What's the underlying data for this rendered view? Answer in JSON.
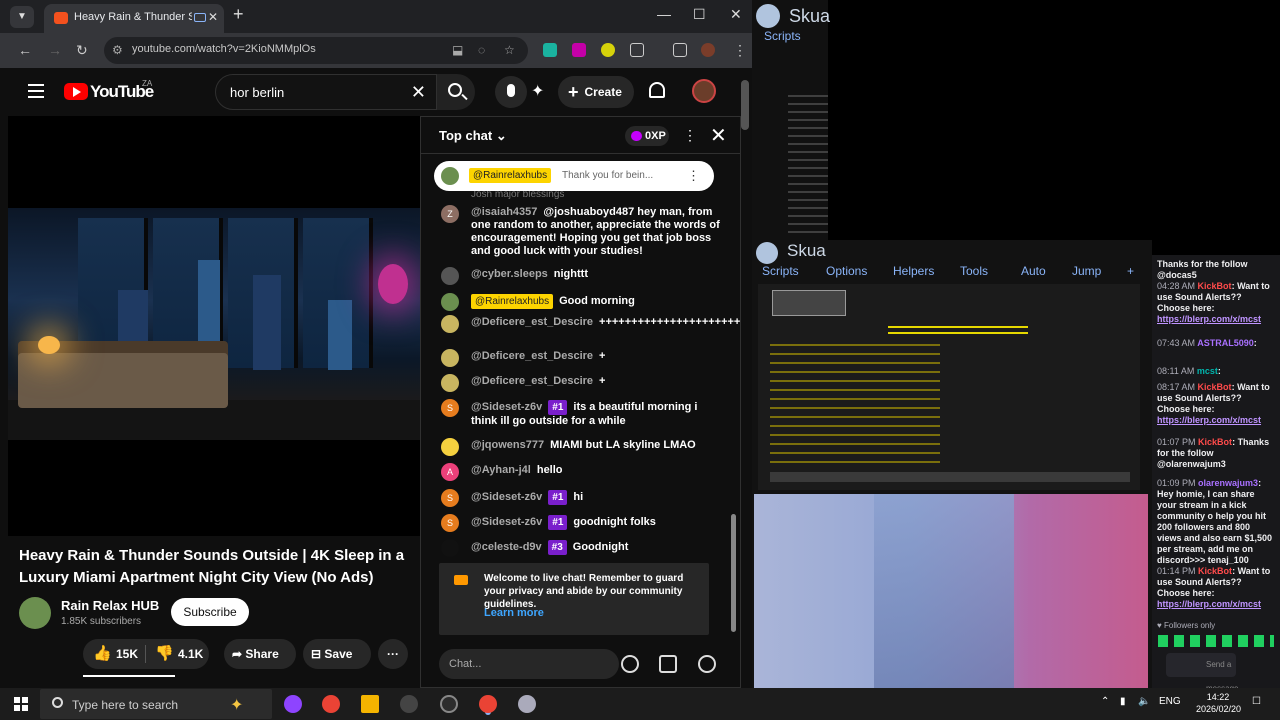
{
  "browser": {
    "tab_title": "Heavy Rain & Thunder Sou",
    "url": "youtube.com/watch?v=2KioNMMplOs"
  },
  "youtube": {
    "logo_text": "YouTube",
    "country": "ZA",
    "search_value": "hor berlin",
    "create_label": "Create",
    "video_title": "Heavy Rain & Thunder Sounds Outside | 4K Sleep in a Luxury Miami Apartment Night City View (No Ads)",
    "channel_name": "Rain Relax HUB",
    "subscribers": "1.85K subscribers",
    "subscribe_label": "Subscribe",
    "likes": "15K",
    "dislikes": "4.1K",
    "share_label": "Share",
    "save_label": "Save"
  },
  "chat": {
    "title": "Top chat",
    "xp": "0XP",
    "pinned": {
      "author": "@Rainrelaxhubs",
      "text": "Thank you for bein..."
    },
    "cut_line": "Josh major blessings",
    "messages": [
      {
        "initial": "Z",
        "color": "#8d6e63",
        "author": "@isaiah4357",
        "badge": "",
        "mod": false,
        "text": "@joshuaboyd487 hey man, from one random to another, appreciate the words of encouragement! Hoping you get that job boss and good luck with your studies!"
      },
      {
        "initial": "",
        "color": "#555555",
        "author": "@cyber.sleeps",
        "badge": "",
        "mod": false,
        "text": "nighttt"
      },
      {
        "initial": "",
        "color": "#6b8f4f",
        "author": "@Rainrelaxhubs",
        "badge": "",
        "mod": true,
        "text": "Good morning"
      },
      {
        "initial": "",
        "color": "#c8b560",
        "author": "@Deficere_est_Descire",
        "badge": "",
        "mod": false,
        "text": "++++++++++++++++++++++"
      },
      {
        "initial": "",
        "color": "#c8b560",
        "author": "@Deficere_est_Descire",
        "badge": "",
        "mod": false,
        "text": "+"
      },
      {
        "initial": "",
        "color": "#c8b560",
        "author": "@Deficere_est_Descire",
        "badge": "",
        "mod": false,
        "text": "+"
      },
      {
        "initial": "S",
        "color": "#e67c1e",
        "author": "@Sideset-z6v",
        "badge": "#1",
        "mod": false,
        "text": "its a beautiful morning i think ill go outside for a while"
      },
      {
        "initial": "",
        "color": "#f4d03f",
        "author": "@jqowens777",
        "badge": "",
        "mod": false,
        "text": "MIAMI but LA skyline LMAO"
      },
      {
        "initial": "A",
        "color": "#ec407a",
        "author": "@Ayhan-j4l",
        "badge": "",
        "mod": false,
        "text": "hello"
      },
      {
        "initial": "S",
        "color": "#e67c1e",
        "author": "@Sideset-z6v",
        "badge": "#1",
        "mod": false,
        "text": "hi"
      },
      {
        "initial": "S",
        "color": "#e67c1e",
        "author": "@Sideset-z6v",
        "badge": "#1",
        "mod": false,
        "text": "goodnight folks"
      },
      {
        "initial": "",
        "color": "#111111",
        "author": "@celeste-d9v",
        "badge": "#3",
        "mod": false,
        "text": "Goodnight"
      }
    ],
    "welcome_text": "Welcome to live chat! Remember to guard your privacy and abide by our community guidelines.",
    "learn_more": "Learn more",
    "input_placeholder": "Chat..."
  },
  "skua_top": {
    "title": "Skua",
    "scripts": "Scripts"
  },
  "skua_main": {
    "title": "Skua",
    "menu": [
      "Scripts",
      "Options",
      "Helpers",
      "Tools",
      "Auto",
      "Jump",
      "+"
    ]
  },
  "twitch": {
    "header": "Thanks for the follow @docas5",
    "entries": [
      {
        "time": "04:28 AM",
        "user": "KickBot",
        "text": "Want to use Sound Alerts?? Choose here:",
        "link": "https://blerp.com/x/mcst"
      },
      {
        "time": "07:43 AM",
        "user": "ASTRAL5090",
        "text": "",
        "link": ""
      },
      {
        "time": "08:11 AM",
        "user": "mcst",
        "text": "",
        "link": ""
      },
      {
        "time": "08:17 AM",
        "user": "KickBot",
        "text": "Want to use Sound Alerts?? Choose here:",
        "link": "https://blerp.com/x/mcst"
      },
      {
        "time": "01:07 PM",
        "user": "KickBot",
        "text": "Thanks for the follow @olarenwajum3",
        "link": ""
      },
      {
        "time": "01:09 PM",
        "user": "olarenwajum3",
        "text": "Hey homie, I can share your stream in a kick community o help you hit 200 followers and 800 views and also earn $1,500 per stream, add me on discord>>> tenaj_100",
        "link": ""
      },
      {
        "time": "01:14 PM",
        "user": "KickBot",
        "text": "Want to use Sound Alerts?? Choose here:",
        "link": "https://blerp.com/x/mcst"
      }
    ],
    "followers_only": "Followers only",
    "send_placeholder": "Send a message"
  },
  "taskbar": {
    "search_placeholder": "Type here to search",
    "lang": "ENG",
    "time": "14:22",
    "date": "2026/02/20"
  }
}
